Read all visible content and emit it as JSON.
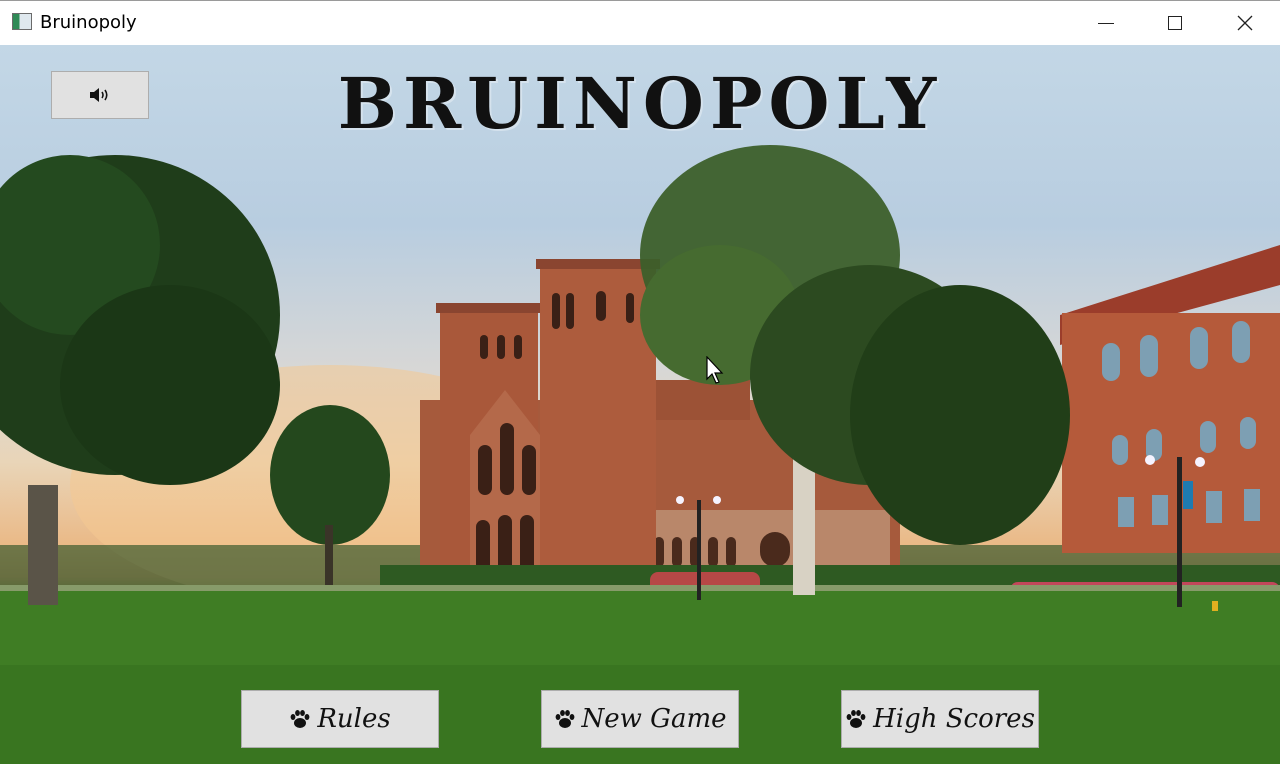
{
  "window": {
    "title": "Bruinopoly",
    "controls": [
      "minimize-icon",
      "maximize-icon",
      "close-icon"
    ]
  },
  "sound_button": {
    "icon": "speaker-icon"
  },
  "game": {
    "title": "BRUINOPOLY"
  },
  "menu": {
    "rules_label": "Rules",
    "new_game_label": "New Game",
    "high_scores_label": "High Scores",
    "button_icon": "paw-icon"
  },
  "colors": {
    "button_bg": "#e1e1e1",
    "button_border": "#adadad",
    "title_text": "#111111",
    "grass": "#3f7c26",
    "brick": "#a2543a"
  }
}
